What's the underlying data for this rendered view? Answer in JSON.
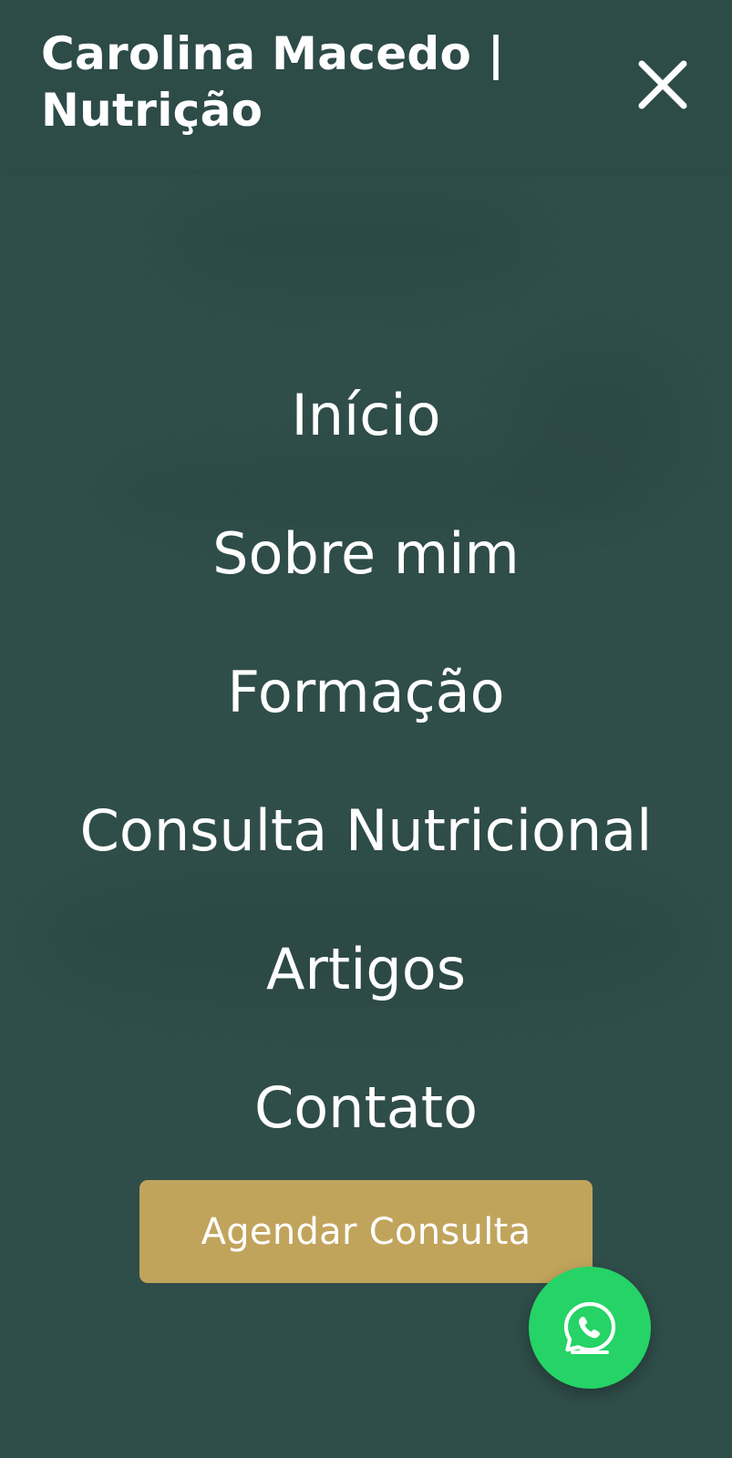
{
  "header": {
    "title": "Carolina Macedo | Nutrição",
    "close_icon": "close-icon"
  },
  "menu": {
    "items": [
      {
        "label": "Início"
      },
      {
        "label": "Sobre mim"
      },
      {
        "label": "Formação"
      },
      {
        "label": "Consulta Nutricional"
      },
      {
        "label": "Artigos"
      },
      {
        "label": "Contato"
      }
    ]
  },
  "cta": {
    "label": "Agendar Consulta"
  },
  "floating": {
    "icon": "whatsapp-icon"
  },
  "colors": {
    "background": "#2f4f4b",
    "header": "#2d4b47",
    "cta": "#c1a45c",
    "whatsapp": "#25d366",
    "text": "#ffffff"
  }
}
